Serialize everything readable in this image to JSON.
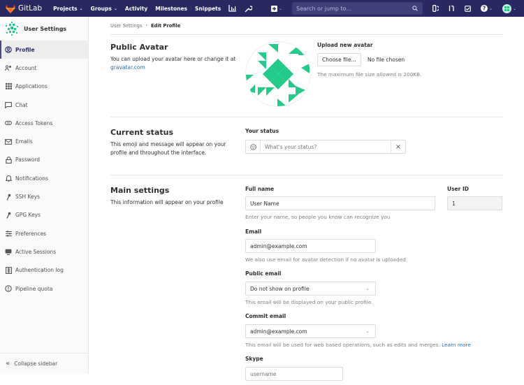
{
  "topnav": {
    "brand": "GitLab",
    "links": [
      {
        "label": "Projects",
        "dropdown": true
      },
      {
        "label": "Groups",
        "dropdown": true
      },
      {
        "label": "Activity",
        "dropdown": false
      },
      {
        "label": "Milestones",
        "dropdown": false
      },
      {
        "label": "Snippets",
        "dropdown": false
      }
    ],
    "icons": [
      "chart-icon",
      "wrench-icon"
    ],
    "search_placeholder": "Search or jump to...",
    "right_icons": [
      "plus-square-icon",
      "issues-icon",
      "merge-request-icon",
      "todo-icon",
      "help-icon",
      "user-avatar"
    ],
    "chevron": "⌄"
  },
  "sidebar": {
    "title": "User Settings",
    "items": [
      {
        "label": "Profile",
        "icon": "profile-icon",
        "active": true
      },
      {
        "label": "Account",
        "icon": "account-icon",
        "active": false
      },
      {
        "label": "Applications",
        "icon": "applications-icon",
        "active": false
      },
      {
        "label": "Chat",
        "icon": "chat-icon",
        "active": false
      },
      {
        "label": "Access Tokens",
        "icon": "token-icon",
        "active": false
      },
      {
        "label": "Emails",
        "icon": "mail-icon",
        "active": false
      },
      {
        "label": "Password",
        "icon": "lock-icon",
        "active": false
      },
      {
        "label": "Notifications",
        "icon": "bell-icon",
        "active": false
      },
      {
        "label": "SSH Keys",
        "icon": "key-icon",
        "active": false
      },
      {
        "label": "GPG Keys",
        "icon": "key-icon",
        "active": false
      },
      {
        "label": "Preferences",
        "icon": "preferences-icon",
        "active": false
      },
      {
        "label": "Active Sessions",
        "icon": "monitor-icon",
        "active": false
      },
      {
        "label": "Authentication log",
        "icon": "log-icon",
        "active": false
      },
      {
        "label": "Pipeline quota",
        "icon": "quota-icon",
        "active": false
      }
    ],
    "collapse_label": "Collapse sidebar"
  },
  "breadcrumb": {
    "parent": "User Settings",
    "separator": "›",
    "current": "Edit Profile"
  },
  "avatar_section": {
    "title": "Public Avatar",
    "description": "You can upload your avatar here or change it at",
    "link": "gravatar.com",
    "upload_label": "Upload new avatar",
    "choose_button": "Choose file...",
    "file_status": "No file chosen",
    "help": "The maximum file size allowed is 200KB."
  },
  "status_section": {
    "title": "Current status",
    "description": "This emoji and message will appear on your profile and throughout the interface.",
    "label": "Your status",
    "placeholder": "What's your status?",
    "clear_glyph": "×"
  },
  "main_settings": {
    "title": "Main settings",
    "description": "This information will appear on your profile",
    "full_name": {
      "label": "Full name",
      "value": "User Name",
      "help": "Enter your name, so people you know can recognize you"
    },
    "user_id": {
      "label": "User ID",
      "value": "1"
    },
    "email": {
      "label": "Email",
      "value": "admin@example.com",
      "help": "We also use email for avatar detection if no avatar is uploaded"
    },
    "public_email": {
      "label": "Public email",
      "value": "Do not show on profile",
      "help": "This email will be displayed on your public profile"
    },
    "commit_email": {
      "label": "Commit email",
      "value": "admin@example.com",
      "help": "This email will be used for web based operations, such as edits and merges.",
      "link": "Learn more"
    },
    "skype": {
      "label": "Skype",
      "placeholder": "username"
    }
  },
  "colors": {
    "nav_bg": "#292961",
    "accent_green": "#22cc88",
    "link": "#1f70b8"
  }
}
